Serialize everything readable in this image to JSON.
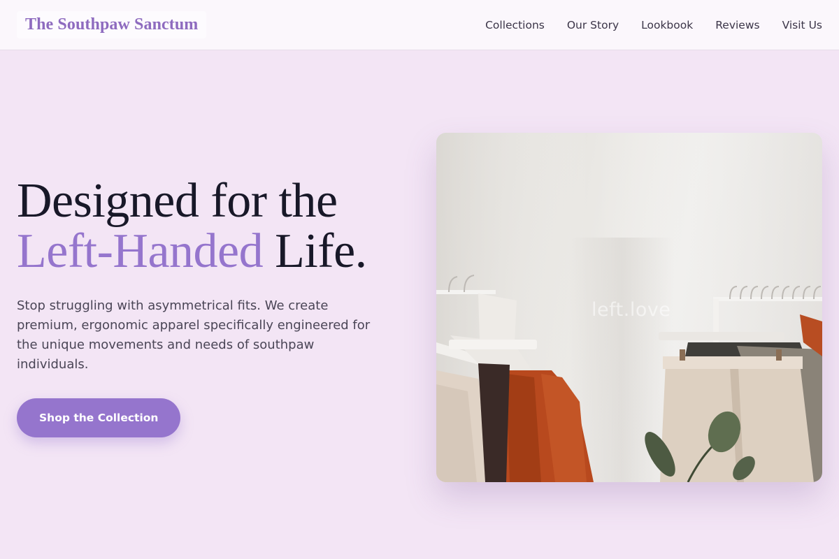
{
  "brand": {
    "name": "The Southpaw Sanctum"
  },
  "nav": {
    "items": [
      {
        "label": "Collections"
      },
      {
        "label": "Our Story"
      },
      {
        "label": "Lookbook"
      },
      {
        "label": "Reviews"
      },
      {
        "label": "Visit Us"
      }
    ]
  },
  "hero": {
    "headline_line1": "Designed for the",
    "headline_accent": "Left-Handed",
    "headline_end": " Life.",
    "subtext": "Stop struggling with asymmetrical fits. We create premium, ergonomic apparel specifically engineered for the unique movements and needs of southpaw individuals.",
    "cta_label": "Shop the Collection",
    "image_watermark": "left.love"
  },
  "colors": {
    "background": "#f3e5f5",
    "accent": "#9575cd",
    "header_bg": "#fbf7fc",
    "headline": "#181828"
  }
}
